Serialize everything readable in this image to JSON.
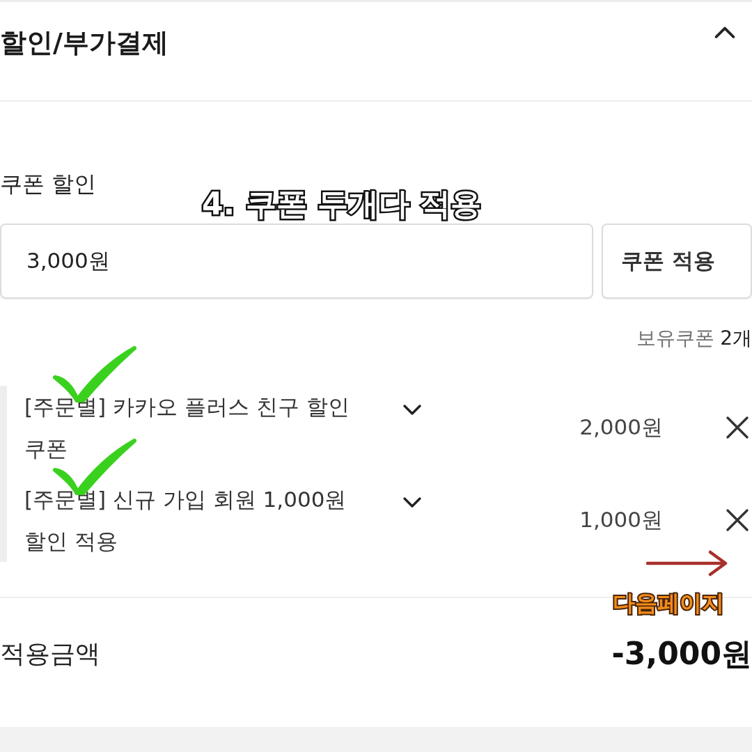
{
  "section": {
    "title": "할인/부가결제",
    "expanded": true
  },
  "coupon": {
    "label": "쿠폰 할인",
    "input": {
      "value": "3,000원"
    },
    "apply_button": "쿠폰 적용",
    "owned_label": "보유쿠폰",
    "owned_count": "2개",
    "items": [
      {
        "name": "[주문별] 카카오 플러스 친구 할인 쿠폰",
        "amount": "2,000원",
        "expanded": false,
        "checked": true
      },
      {
        "name": "[주문별] 신규 가입 회원 1,000원 할인 적용",
        "amount": "1,000원",
        "expanded": false,
        "checked": true
      }
    ]
  },
  "total": {
    "label": "적용금액",
    "amount": "-3,000원"
  },
  "annotations": {
    "caption": "4. 쿠폰 두개다 적용",
    "next_page": "다음페이지"
  }
}
